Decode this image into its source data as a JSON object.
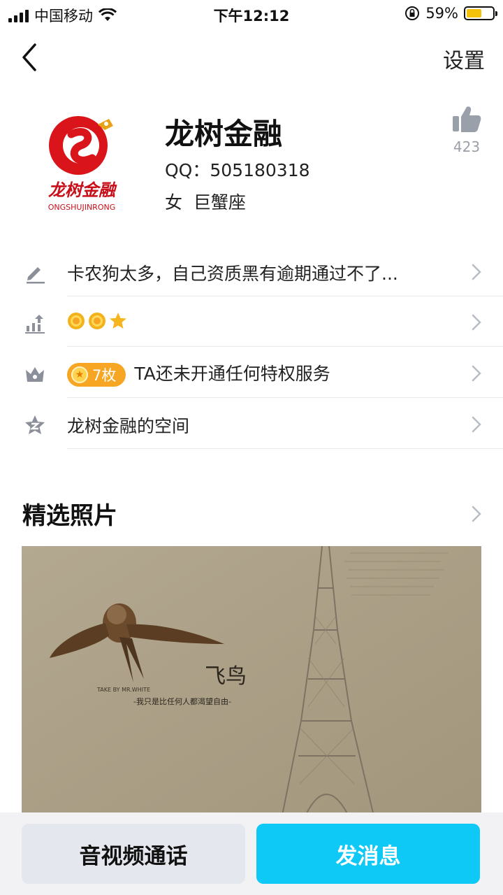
{
  "status_bar": {
    "carrier": "中国移动",
    "time": "下午12:12",
    "battery_text": "59%",
    "battery_level": 0.59,
    "battery_color": "#f4c10b"
  },
  "nav": {
    "settings_label": "设置"
  },
  "profile": {
    "avatar_text": "龙树金融",
    "avatar_subtext": "ONGSHUJINRONG",
    "name": "龙树金融",
    "qq": "QQ：505180318",
    "gender": "女",
    "zodiac": "巨蟹座",
    "likes": "423"
  },
  "rows": {
    "signature": "卡农狗太多，自己资质黑有逾期通过不了...",
    "level_icons": [
      "sun-icon",
      "sun-icon",
      "star-icon"
    ],
    "badge_count": "7枚",
    "privilege": "TA还未开通任何特权服务",
    "space": "龙树金融的空间"
  },
  "photos": {
    "title": "精选照片",
    "caption_small": "TAKE BY MR.WHITE",
    "caption": "-我只是比任何人都渴望自由-",
    "calligraphy": "飞鸟"
  },
  "actions": {
    "call_label": "音视频通话",
    "message_label": "发消息"
  },
  "colors": {
    "accent": "#0ec8f6",
    "badge": "#f6a623",
    "avatar_red": "#d9151b"
  }
}
